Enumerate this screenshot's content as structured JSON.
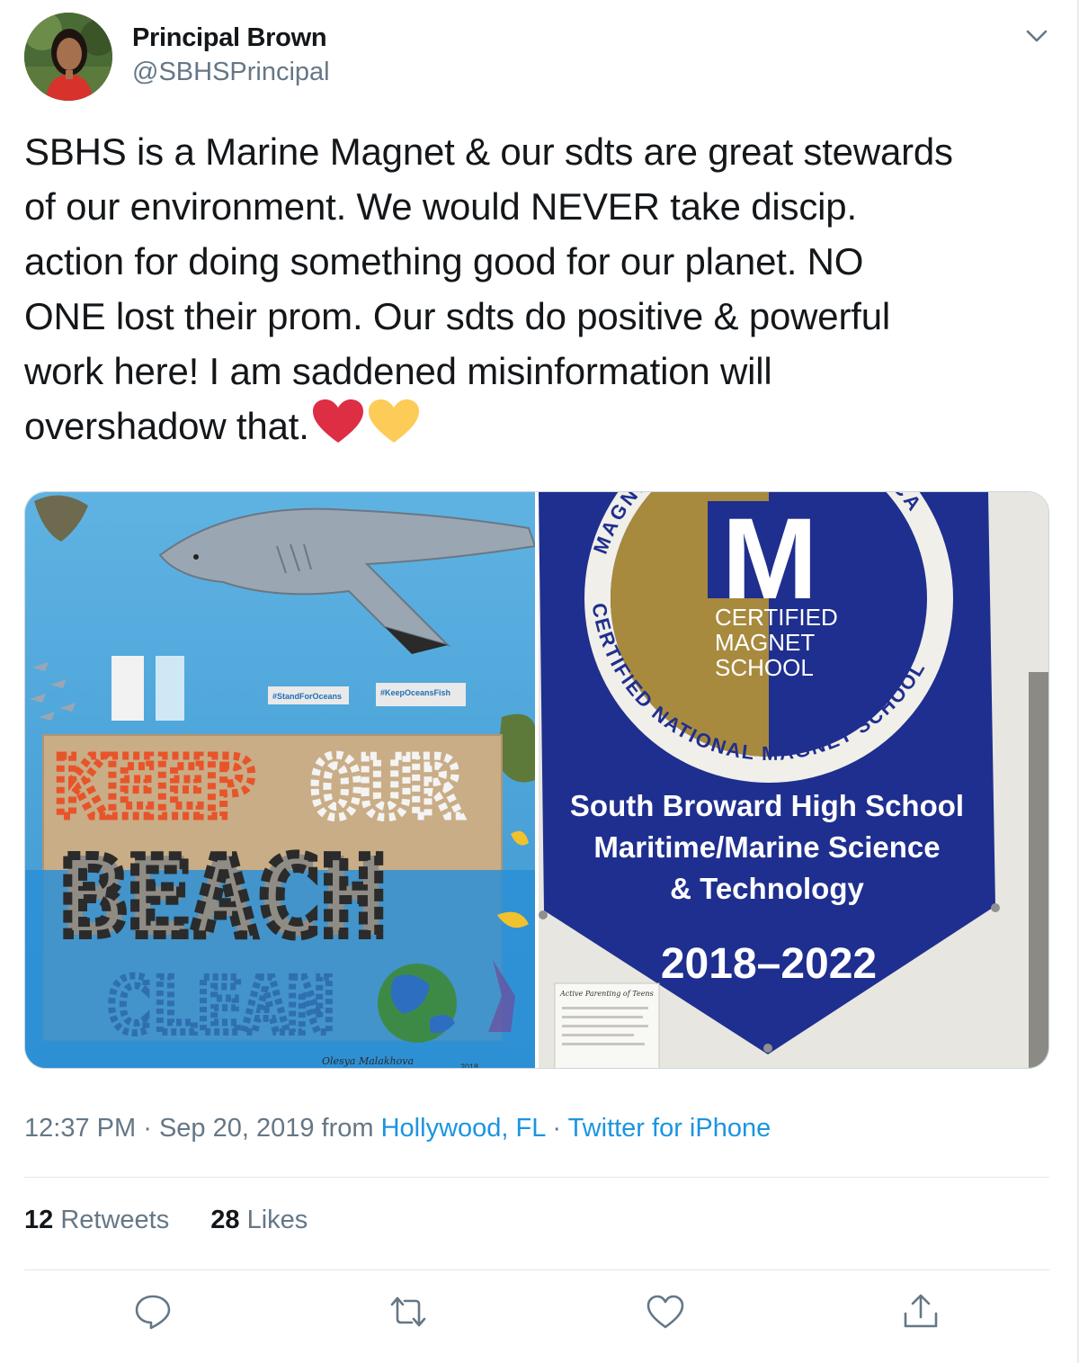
{
  "author": {
    "display_name": "Principal Brown",
    "handle": "@SBHSPrincipal"
  },
  "tweet": {
    "lines": [
      "SBHS is a Marine Magnet & our sdts are great stewards",
      "of our environment. We would NEVER take discip.",
      "action for doing something good for our planet. NO",
      "ONE lost their prom. Our sdts do positive & powerful",
      "work here! I am saddened misinformation will",
      "overshadow that."
    ],
    "emojis": [
      "red-heart",
      "yellow-heart"
    ]
  },
  "media": {
    "left_photo": {
      "sign_texts": [
        "#StandForOceans",
        "#KeepOceansFish"
      ],
      "words": [
        "KEEP",
        "OUR",
        "BEACH",
        "CLEAN"
      ],
      "signature": "Olesya Malakhova",
      "year": "2018"
    },
    "right_photo": {
      "seal_letter": "M",
      "seal_lines": [
        "CERTIFIED",
        "MAGNET",
        "SCHOOL"
      ],
      "seal_ring_top": "MAGNET SCHOOLS OF AMERICA",
      "seal_ring_bottom": "CERTIFIED NATIONAL MAGNET SCHOOL",
      "banner_lines": [
        "South Broward High School",
        "Maritime/Marine Science",
        "& Technology"
      ],
      "banner_years": "2018–2022",
      "paper_title": "Active Parenting of Teens"
    }
  },
  "meta": {
    "time": "12:37 PM",
    "separator": "·",
    "date": "Sep 20, 2019",
    "from_label": "from",
    "location": "Hollywood, FL",
    "source": "Twitter for iPhone"
  },
  "stats": {
    "retweets_count": "12",
    "retweets_label": "Retweets",
    "likes_count": "28",
    "likes_label": "Likes"
  },
  "actions": [
    "reply-icon",
    "retweet-icon",
    "like-icon",
    "share-icon"
  ],
  "colors": {
    "text": "#14171a",
    "secondary": "#657786",
    "link": "#1b95e0",
    "divider": "#e1e8ed",
    "heart_red": "#dd2e44",
    "heart_yellow": "#fdcb58",
    "banner_blue": "#1f2f8f"
  }
}
